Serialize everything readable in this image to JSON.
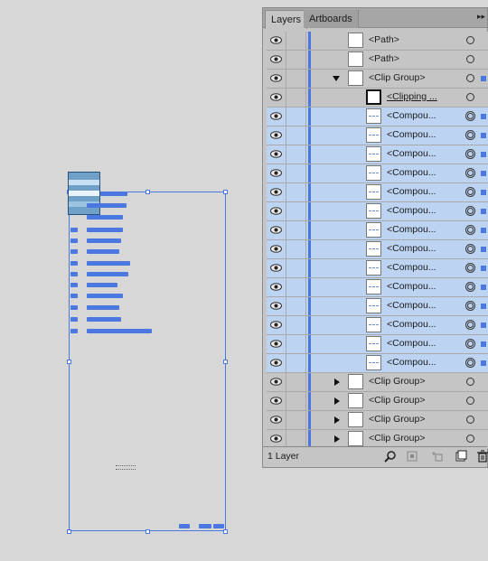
{
  "tabs": [
    {
      "label": "Layers",
      "active": true
    },
    {
      "label": "Artboards",
      "active": false
    }
  ],
  "layers": [
    {
      "name": "<Path>",
      "indent": 0,
      "expander": "none",
      "selected": false,
      "target": "single",
      "thumb": "plain"
    },
    {
      "name": "<Path>",
      "indent": 0,
      "expander": "none",
      "selected": false,
      "target": "single",
      "thumb": "plain"
    },
    {
      "name": "<Clip Group>",
      "indent": 0,
      "expander": "down",
      "selected": false,
      "target": "single",
      "thumb": "plain",
      "sel_square": true
    },
    {
      "name": "<Clipping ...",
      "indent": 1,
      "expander": "none",
      "selected": false,
      "target": "single",
      "thumb": "dark",
      "underline": true
    },
    {
      "name": "<Compou...",
      "indent": 1,
      "expander": "none",
      "selected": true,
      "target": "double",
      "thumb": "dashed",
      "sel_square": true
    },
    {
      "name": "<Compou...",
      "indent": 1,
      "expander": "none",
      "selected": true,
      "target": "double",
      "thumb": "dashed",
      "sel_square": true
    },
    {
      "name": "<Compou...",
      "indent": 1,
      "expander": "none",
      "selected": true,
      "target": "double",
      "thumb": "dashed",
      "sel_square": true
    },
    {
      "name": "<Compou...",
      "indent": 1,
      "expander": "none",
      "selected": true,
      "target": "double",
      "thumb": "dashed",
      "sel_square": true
    },
    {
      "name": "<Compou...",
      "indent": 1,
      "expander": "none",
      "selected": true,
      "target": "double",
      "thumb": "dashed",
      "sel_square": true
    },
    {
      "name": "<Compou...",
      "indent": 1,
      "expander": "none",
      "selected": true,
      "target": "double",
      "thumb": "dashed",
      "sel_square": true
    },
    {
      "name": "<Compou...",
      "indent": 1,
      "expander": "none",
      "selected": true,
      "target": "double",
      "thumb": "dashed",
      "sel_square": true
    },
    {
      "name": "<Compou...",
      "indent": 1,
      "expander": "none",
      "selected": true,
      "target": "double",
      "thumb": "dashed",
      "sel_square": true
    },
    {
      "name": "<Compou...",
      "indent": 1,
      "expander": "none",
      "selected": true,
      "target": "double",
      "thumb": "dashed",
      "sel_square": true
    },
    {
      "name": "<Compou...",
      "indent": 1,
      "expander": "none",
      "selected": true,
      "target": "double",
      "thumb": "dashed",
      "sel_square": true
    },
    {
      "name": "<Compou...",
      "indent": 1,
      "expander": "none",
      "selected": true,
      "target": "double",
      "thumb": "dashed",
      "sel_square": true
    },
    {
      "name": "<Compou...",
      "indent": 1,
      "expander": "none",
      "selected": true,
      "target": "double",
      "thumb": "dashed",
      "sel_square": true
    },
    {
      "name": "<Compou...",
      "indent": 1,
      "expander": "none",
      "selected": true,
      "target": "double",
      "thumb": "dashed",
      "sel_square": true
    },
    {
      "name": "<Compou...",
      "indent": 1,
      "expander": "none",
      "selected": true,
      "target": "double",
      "thumb": "dashed",
      "sel_square": true
    },
    {
      "name": "<Clip Group>",
      "indent": 0,
      "expander": "right",
      "selected": false,
      "target": "single",
      "thumb": "plain"
    },
    {
      "name": "<Clip Group>",
      "indent": 0,
      "expander": "right",
      "selected": false,
      "target": "single",
      "thumb": "plain"
    },
    {
      "name": "<Clip Group>",
      "indent": 0,
      "expander": "right",
      "selected": false,
      "target": "single",
      "thumb": "plain"
    },
    {
      "name": "<Clip Group>",
      "indent": 0,
      "expander": "right",
      "selected": false,
      "target": "single",
      "thumb": "plain"
    }
  ],
  "footer": {
    "layer_count": "1 Layer",
    "icons": [
      "search-icon",
      "make-clipping-mask-icon",
      "create-sublayer-icon",
      "create-new-layer-icon",
      "trash-icon"
    ]
  },
  "colors": {
    "selection": "#4a78e0",
    "row_selected": "#bcd3f2",
    "panel_bg": "#c5c5c5",
    "canvas_bg": "#d7d7d7"
  }
}
